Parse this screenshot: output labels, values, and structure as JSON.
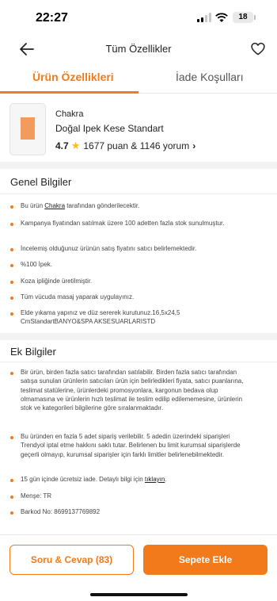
{
  "status": {
    "time": "22:27",
    "battery": "18"
  },
  "nav": {
    "title": "Tüm Özellikler"
  },
  "tabs": [
    {
      "label": "Ürün Özellikleri",
      "active": true
    },
    {
      "label": "İade Koşulları",
      "active": false
    }
  ],
  "product": {
    "brand": "Chakra",
    "name": "Doğal Ipek Kese Standart",
    "rating": "4.7",
    "reviews": "1677 puan & 1146 yorum"
  },
  "general": {
    "title": "Genel Bilgiler",
    "items": [
      {
        "pre": "Bu ürün ",
        "link": "Chakra",
        "post": " tarafından gönderilecektir."
      },
      {
        "text": "Kampanya fiyatından satılmak üzere 100 adetten fazla stok sunulmuştur."
      },
      {
        "text": "İncelemiş olduğunuz ürünün satış fiyatını satıcı belirlemektedir."
      },
      {
        "text": "%100 İpek."
      },
      {
        "text": "Koza ipliğinde üretilmiştir."
      },
      {
        "text": "Tüm vücuda masaj yaparak uygulayınız."
      },
      {
        "text": "Elde yıkama yapınız ve düz sererek kurutunuz.16,5x24,5 CmStandartBANYO&SPA AKSESUARLARISTD"
      }
    ]
  },
  "extra": {
    "title": "Ek Bilgiler",
    "items": [
      {
        "text": "Bir ürün, birden fazla satıcı tarafından satılabilir. Birden fazla satıcı tarafından satışa sunulan ürünlerin satıcıları ürün için belirledikleri fiyata, satıcı puanlarına, teslimat statülerine, ürünlerdeki promosyonlara, kargonun bedava olup olmamasına ve ürünlerin hızlı teslimat ile teslim edilip edilememesine, ürünlerin stok ve kategorileri bilgilerine göre sıralanmaktadır."
      },
      {
        "text": "Bu üründen en fazla 5 adet sipariş verilebilir. 5 adedin üzerindeki siparişleri Trendyol iptal etme hakkını saklı tutar. Belirlenen bu limit kurumsal siparişlerde geçerli olmayıp, kurumsal siparişler için farklı limitler belirlenebilmektedir."
      },
      {
        "pre": "15 gün içinde ücretsiz iade. Detaylı bilgi için ",
        "link": "tıklayın",
        "post": "."
      },
      {
        "text": "Menşe: TR"
      },
      {
        "text": "Barkod No: 8699137769892"
      }
    ]
  },
  "actions": {
    "qa_label": "Soru & Cevap (83)",
    "cart_label": "Sepete Ekle"
  },
  "colors": {
    "accent": "#f27a1a",
    "star": "#ffc000"
  }
}
